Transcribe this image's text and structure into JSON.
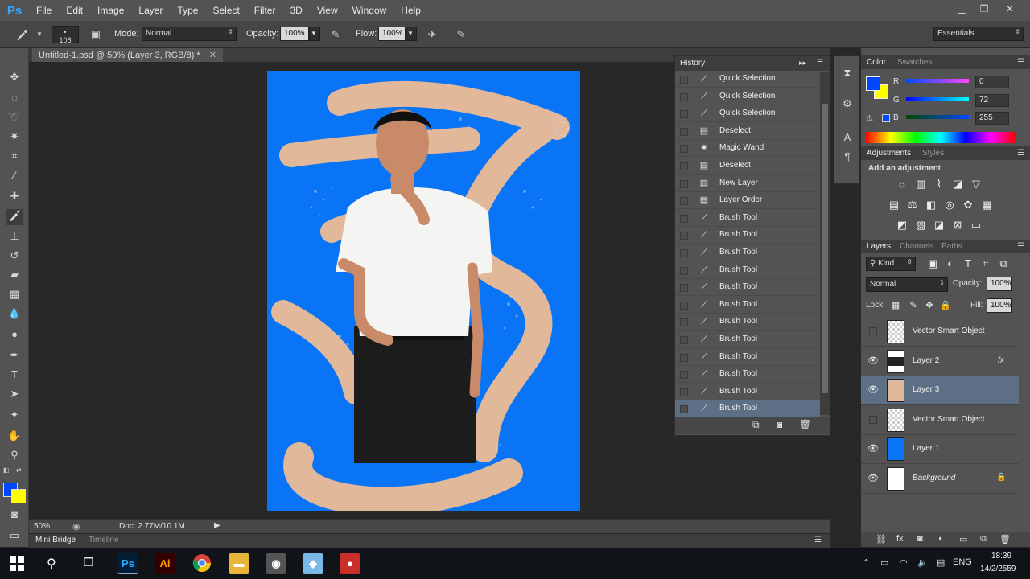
{
  "app": {
    "logo": "Ps"
  },
  "menu": [
    "File",
    "Edit",
    "Image",
    "Layer",
    "Type",
    "Select",
    "Filter",
    "3D",
    "View",
    "Window",
    "Help"
  ],
  "options": {
    "brush_size": "108",
    "mode_label": "Mode:",
    "mode_value": "Normal",
    "opacity_label": "Opacity:",
    "opacity_value": "100%",
    "flow_label": "Flow:",
    "flow_value": "100%",
    "workspace": "Essentials"
  },
  "document": {
    "tab_title": "Untitled-1.psd @ 50% (Layer 3, RGB/8) *",
    "zoom": "50%",
    "doc_size": "Doc: 2.77M/10.1M"
  },
  "bottom_tabs": [
    "Mini Bridge",
    "Timeline"
  ],
  "history": {
    "title": "History",
    "items": [
      {
        "label": "Quick Selection",
        "icon": "quick-selection-icon"
      },
      {
        "label": "Quick Selection",
        "icon": "quick-selection-icon"
      },
      {
        "label": "Quick Selection",
        "icon": "quick-selection-icon"
      },
      {
        "label": "Deselect",
        "icon": "doc-icon"
      },
      {
        "label": "Magic Wand",
        "icon": "magic-wand-icon"
      },
      {
        "label": "Deselect",
        "icon": "doc-icon"
      },
      {
        "label": "New Layer",
        "icon": "doc-icon"
      },
      {
        "label": "Layer Order",
        "icon": "doc-icon"
      },
      {
        "label": "Brush Tool",
        "icon": "brush-icon"
      },
      {
        "label": "Brush Tool",
        "icon": "brush-icon"
      },
      {
        "label": "Brush Tool",
        "icon": "brush-icon"
      },
      {
        "label": "Brush Tool",
        "icon": "brush-icon"
      },
      {
        "label": "Brush Tool",
        "icon": "brush-icon"
      },
      {
        "label": "Brush Tool",
        "icon": "brush-icon"
      },
      {
        "label": "Brush Tool",
        "icon": "brush-icon"
      },
      {
        "label": "Brush Tool",
        "icon": "brush-icon"
      },
      {
        "label": "Brush Tool",
        "icon": "brush-icon"
      },
      {
        "label": "Brush Tool",
        "icon": "brush-icon"
      },
      {
        "label": "Brush Tool",
        "icon": "brush-icon"
      },
      {
        "label": "Brush Tool",
        "icon": "brush-icon"
      }
    ]
  },
  "color_panel": {
    "tabs": [
      "Color",
      "Swatches"
    ],
    "r_label": "R",
    "r_value": "0",
    "g_label": "G",
    "g_value": "72",
    "b_label": "B",
    "b_value": "255",
    "foreground": "#0048ff",
    "background": "#ffff00"
  },
  "adjustments_panel": {
    "tabs": [
      "Adjustments",
      "Styles"
    ],
    "heading": "Add an adjustment"
  },
  "layers_panel": {
    "tabs": [
      "Layers",
      "Channels",
      "Paths"
    ],
    "kind_label": "Kind",
    "blend_mode": "Normal",
    "opacity_label": "Opacity:",
    "opacity_value": "100%",
    "lock_label": "Lock:",
    "fill_label": "Fill:",
    "fill_value": "100%",
    "layers": [
      {
        "name": "Vector Smart Object",
        "visible": false
      },
      {
        "name": "Layer 2",
        "visible": true,
        "fx": "fx"
      },
      {
        "name": "Layer 3",
        "visible": true
      },
      {
        "name": "Vector Smart Object",
        "visible": false
      },
      {
        "name": "Layer 1",
        "visible": true
      },
      {
        "name": "Background",
        "visible": true
      }
    ]
  },
  "taskbar": {
    "apps": [
      "Ps",
      "Ai"
    ],
    "language": "ENG",
    "time": "18:39",
    "date": "14/2/2559"
  },
  "colors": {
    "canvas_blue": "#0a74f6",
    "paint_stroke": "#e2b89a",
    "selection": "#5d6f84"
  }
}
